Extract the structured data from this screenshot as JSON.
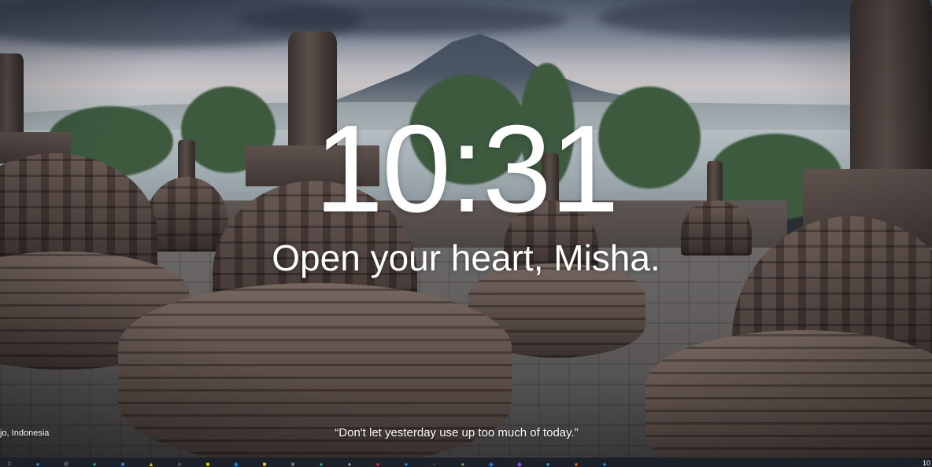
{
  "clock": {
    "time": "10:31"
  },
  "greeting": {
    "text": "Open your heart, Misha."
  },
  "quote": {
    "text": "“Don't let yesterday use up too much of today.”"
  },
  "background": {
    "location_text": "jo, Indonesia"
  },
  "taskbar": {
    "clock_text": "10",
    "icons": [
      {
        "name": "start-icon",
        "glyph": "⚐",
        "color": "#9aa3b2"
      },
      {
        "name": "browser-icon",
        "glyph": "●",
        "color": "#2f86d8"
      },
      {
        "name": "settings-icon",
        "glyph": "⚙",
        "color": "#7d8a99"
      },
      {
        "name": "chrome-icon",
        "glyph": "●",
        "color": "#3aa757"
      },
      {
        "name": "store-icon",
        "glyph": "■",
        "color": "#2b7fd6"
      },
      {
        "name": "photos-icon",
        "glyph": "▲",
        "color": "#e0b020"
      },
      {
        "name": "app-icon",
        "glyph": "■",
        "color": "#4a4f58"
      },
      {
        "name": "notes-icon",
        "glyph": "■",
        "color": "#e8c400"
      },
      {
        "name": "mail-icon",
        "glyph": "◆",
        "color": "#1f73c8"
      },
      {
        "name": "folder-icon",
        "glyph": "■",
        "color": "#f2c037"
      },
      {
        "name": "calculator-icon",
        "glyph": "■",
        "color": "#6e7885"
      },
      {
        "name": "chrome-alt-icon",
        "glyph": "●",
        "color": "#35a853"
      },
      {
        "name": "app-alt-icon",
        "glyph": "●",
        "color": "#8a94a3"
      },
      {
        "name": "record-icon",
        "glyph": "●",
        "color": "#d93025"
      },
      {
        "name": "edge-icon",
        "glyph": "●",
        "color": "#1e88d2"
      },
      {
        "name": "terminal-icon",
        "glyph": "▪",
        "color": "#4b5260"
      },
      {
        "name": "game-icon",
        "glyph": "●",
        "color": "#5aa84a"
      },
      {
        "name": "editor-icon",
        "glyph": "◆",
        "color": "#2d6fd0"
      },
      {
        "name": "media-icon",
        "glyph": "◆",
        "color": "#8a4ad8"
      },
      {
        "name": "chat-icon",
        "glyph": "●",
        "color": "#24a0e0"
      },
      {
        "name": "firefox-icon",
        "glyph": "●",
        "color": "#e0662a"
      },
      {
        "name": "network-icon",
        "glyph": "●",
        "color": "#3b87d8"
      }
    ]
  }
}
